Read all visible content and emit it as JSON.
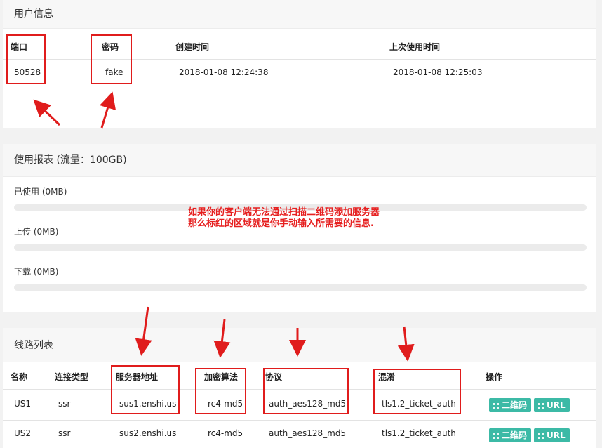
{
  "user_info": {
    "title": "用户信息",
    "headers": {
      "port": "端口",
      "password": "密码",
      "created": "创建时间",
      "last_used": "上次使用时间"
    },
    "row": {
      "port": "50528",
      "password": "fake",
      "created": "2018-01-08 12:24:38",
      "last_used": "2018-01-08 12:25:03"
    }
  },
  "usage": {
    "title": "使用报表 (流量：100GB)",
    "used_label": "已使用 (0MB)",
    "upload_label": "上传 (0MB)",
    "download_label": "下载 (0MB)",
    "used_fraction": 0,
    "upload_fraction": 0,
    "download_fraction": 0
  },
  "annotation": {
    "line1": "如果你的客户端无法通过扫描二维码添加服务器",
    "line2": "那么标红的区域就是你手动输入所需要的信息."
  },
  "lines": {
    "title": "线路列表",
    "headers": {
      "name": "名称",
      "type": "连接类型",
      "server": "服务器地址",
      "method": "加密算法",
      "protocol": "协议",
      "obfs": "混淆",
      "actions": "操作"
    },
    "rows": [
      {
        "name": "US1",
        "type": "ssr",
        "server": "sus1.enshi.us",
        "method": "rc4-md5",
        "protocol": "auth_aes128_md5",
        "obfs": "tls1.2_ticket_auth",
        "qr_label": "二维码",
        "url_label": "URL"
      },
      {
        "name": "US2",
        "type": "ssr",
        "server": "sus2.enshi.us",
        "method": "rc4-md5",
        "protocol": "auth_aes128_md5",
        "obfs": "tls1.2_ticket_auth",
        "qr_label": "二维码",
        "url_label": "URL"
      }
    ]
  },
  "colors": {
    "highlight": "#e01c1c",
    "button": "#3cbaa6",
    "note": "#e62020"
  },
  "icons": {
    "button_icon": "qrcode-icon"
  }
}
